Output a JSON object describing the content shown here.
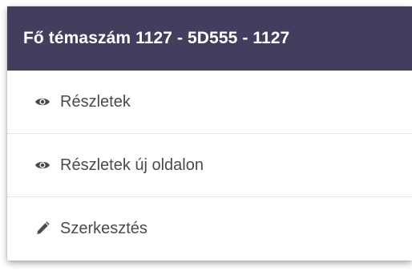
{
  "menu": {
    "title": "Fő témaszám 1127 - 5D555 - 1127",
    "items": [
      {
        "label": "Részletek",
        "icon": "eye-icon"
      },
      {
        "label": "Részletek új oldalon",
        "icon": "eye-icon"
      },
      {
        "label": "Szerkesztés",
        "icon": "pencil-icon"
      }
    ]
  },
  "colors": {
    "header_bg": "#433d5e",
    "header_text": "#ffffff",
    "item_text": "#4a4a4a",
    "divider": "#e6e6e6"
  }
}
